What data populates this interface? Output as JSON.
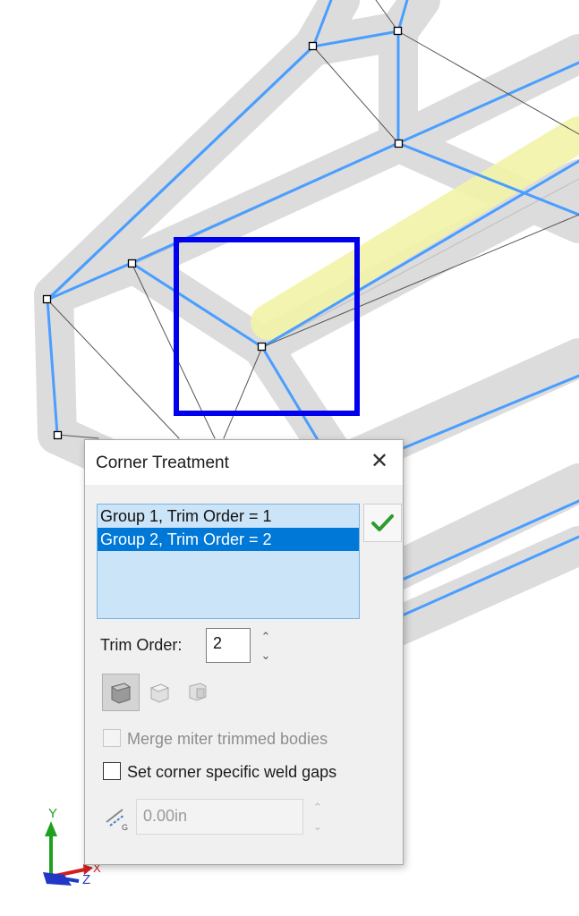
{
  "dialog": {
    "title": "Corner Treatment",
    "groups": [
      {
        "label": "Group 1, Trim Order = 1",
        "selected": false
      },
      {
        "label": "Group 2, Trim Order = 2",
        "selected": true
      }
    ],
    "trim_order_label": "Trim Order:",
    "trim_order_value": "2",
    "merge_miter_label": "Merge miter trimmed bodies",
    "merge_miter_checked": false,
    "merge_miter_enabled": false,
    "weld_gaps_label": "Set corner specific weld gaps",
    "weld_gaps_checked": false,
    "weld_gap_value": "0.00in",
    "weld_gap_icon_label": "G"
  },
  "triad": {
    "y_label": "Y",
    "x_label": "X",
    "z_label": "Z"
  },
  "colors": {
    "selection_box": "#0000ee",
    "frame_blue": "#4a9eff",
    "highlight_member": "#f3f3a8",
    "list_selected": "#0078d7",
    "checkmark": "#2e9b2e"
  },
  "icons": [
    "close-icon",
    "checkmark-icon",
    "spin-up-icon",
    "spin-down-icon",
    "end-trim-icon",
    "end-miter-icon",
    "end-butt-icon",
    "weld-gap-icon"
  ]
}
